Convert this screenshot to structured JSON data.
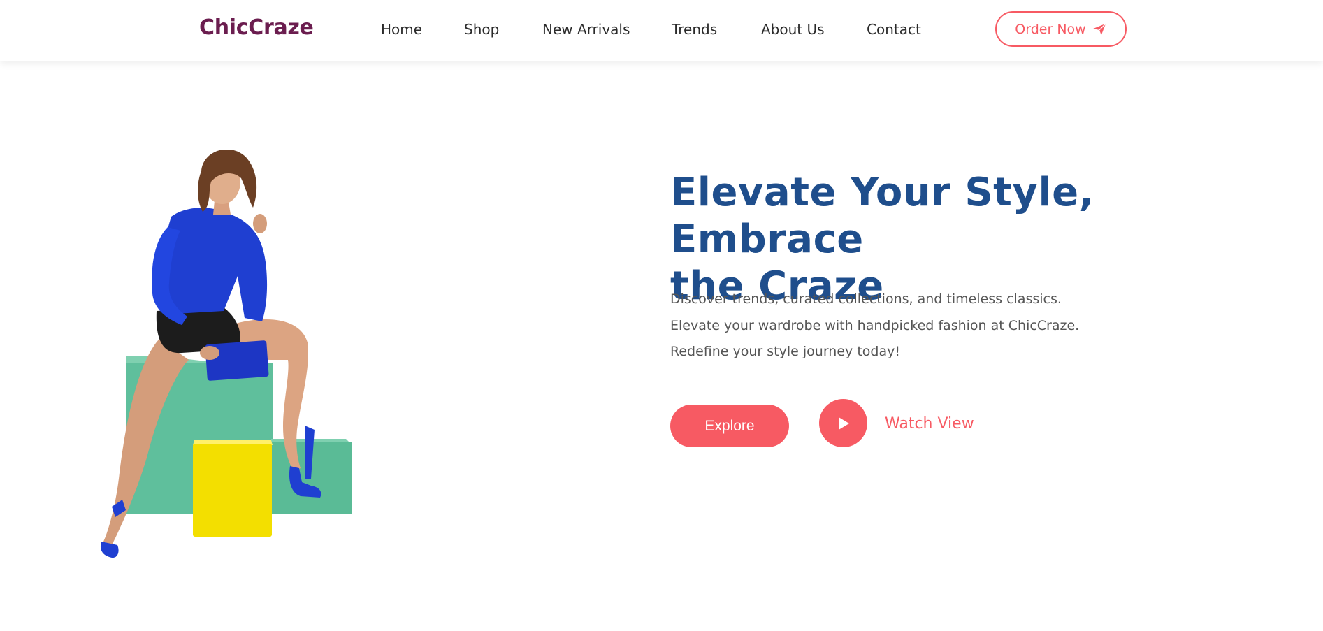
{
  "header": {
    "logo": "ChicCraze",
    "nav": [
      "Home",
      "Shop",
      "New Arrivals",
      "Trends",
      "About Us",
      "Contact"
    ],
    "order_label": "Order Now",
    "order_icon": "paper-plane-icon"
  },
  "hero": {
    "title_line1": "Elevate Your Style, Embrace",
    "title_line2": "the Craze",
    "desc": [
      "Discover trends, curated collections, and timeless classics.",
      "Elevate your wardrobe with handpicked fashion at ChicCraze.",
      "Redefine your style journey today!"
    ],
    "explore_label": "Explore",
    "play_icon": "play-icon",
    "watch_label": "Watch View"
  },
  "colors": {
    "accent": "#f75a63",
    "logo": "#6b1d4f",
    "title": "#1f4e8c",
    "green_block": "#5fbf9c",
    "yellow_block": "#f3df00",
    "outfit_blue": "#1f3fd1"
  }
}
